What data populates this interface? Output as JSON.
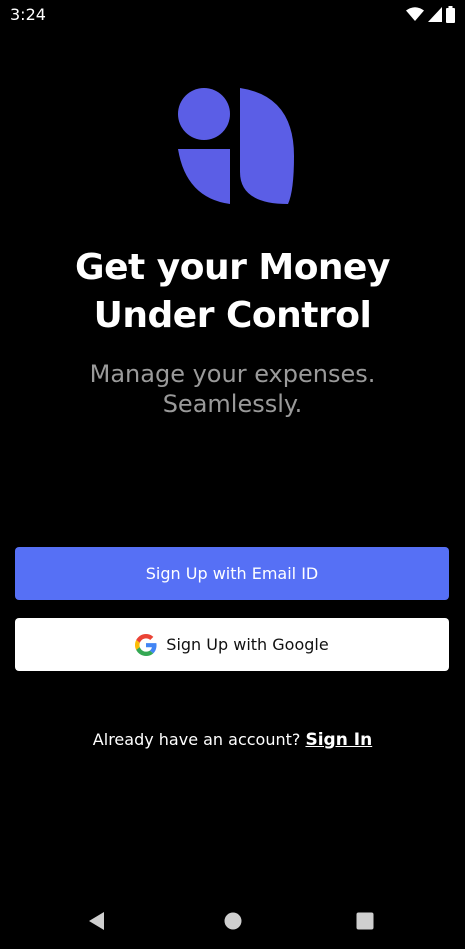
{
  "status_bar": {
    "time": "3:24",
    "icons": [
      "wifi-icon",
      "signal-icon",
      "battery-icon"
    ]
  },
  "logo": {
    "name": "app-logo",
    "color": "#5b5ee6"
  },
  "headline": {
    "line1": "Get your Money",
    "line2": "Under Control"
  },
  "subtitle": {
    "line1": "Manage your expenses.",
    "line2": "Seamlessly."
  },
  "buttons": {
    "email_label": "Sign Up with Email ID",
    "google_label": "Sign Up with Google"
  },
  "signin": {
    "prompt": "Already have an account?",
    "link": "Sign In"
  },
  "nav_bar": {
    "icons": [
      "back-icon",
      "home-icon",
      "recents-icon"
    ]
  },
  "colors": {
    "background": "#000000",
    "primary": "#5670f5",
    "logo": "#5b5ee6",
    "subtitle": "#9a9a9a"
  }
}
